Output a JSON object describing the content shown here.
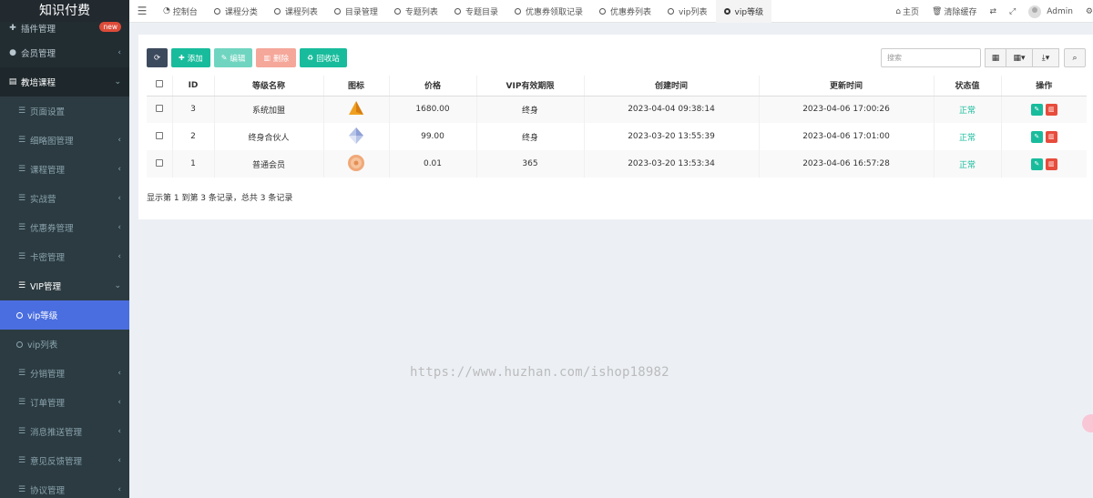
{
  "logo": "知识付费",
  "sidebar": {
    "first": {
      "label": "插件管理",
      "badge": "new"
    },
    "items": [
      {
        "label": "会员管理",
        "icon": "user-icon"
      },
      {
        "label": "教培课程",
        "icon": "book-icon"
      },
      {
        "label": "页面设置",
        "icon": "list-icon"
      },
      {
        "label": "细略图管理",
        "icon": "list-icon"
      },
      {
        "label": "课程管理",
        "icon": "list-icon"
      },
      {
        "label": "实战营",
        "icon": "list-icon"
      },
      {
        "label": "优惠券管理",
        "icon": "list-icon"
      },
      {
        "label": "卡密管理",
        "icon": "list-icon"
      },
      {
        "label": "VIP管理",
        "icon": "list-icon"
      },
      {
        "label": "vip等级",
        "icon": "circle-icon"
      },
      {
        "label": "vip列表",
        "icon": "circle-icon"
      },
      {
        "label": "分销管理",
        "icon": "list-icon"
      },
      {
        "label": "订单管理",
        "icon": "list-icon"
      },
      {
        "label": "消息推送管理",
        "icon": "list-icon"
      },
      {
        "label": "意见反馈管理",
        "icon": "list-icon"
      },
      {
        "label": "协议管理",
        "icon": "list-icon"
      }
    ]
  },
  "topbar": {
    "tabs": [
      {
        "label": "控制台"
      },
      {
        "label": "课程分类"
      },
      {
        "label": "课程列表"
      },
      {
        "label": "目录管理"
      },
      {
        "label": "专题列表"
      },
      {
        "label": "专题目录"
      },
      {
        "label": "优惠券领取记录"
      },
      {
        "label": "优惠券列表"
      },
      {
        "label": "vip列表"
      },
      {
        "label": "vip等级"
      }
    ],
    "home": "主页",
    "clear_cache": "清除缓存",
    "user": "Admin"
  },
  "toolbar": {
    "add": "添加",
    "edit": "编辑",
    "delete": "删除",
    "recycle": "回收站",
    "search_placeholder": "搜索"
  },
  "table": {
    "headers": [
      "ID",
      "等级名称",
      "图标",
      "价格",
      "VIP有效期限",
      "创建时间",
      "更新时间",
      "状态值",
      "操作"
    ],
    "rows": [
      {
        "id": "3",
        "name": "系统加盟",
        "price": "1680.00",
        "period": "终身",
        "created": "2023-04-04 09:38:14",
        "updated": "2023-04-06 17:00:26",
        "status": "正常"
      },
      {
        "id": "2",
        "name": "终身合伙人",
        "price": "99.00",
        "period": "终身",
        "created": "2023-03-20 13:55:39",
        "updated": "2023-04-06 17:01:00",
        "status": "正常"
      },
      {
        "id": "1",
        "name": "普通会员",
        "price": "0.01",
        "period": "365",
        "created": "2023-03-20 13:53:34",
        "updated": "2023-04-06 16:57:28",
        "status": "正常"
      }
    ],
    "footer": "显示第 1 到第 3 条记录，总共 3 条记录"
  },
  "watermark": "https://www.huzhan.com/ishop18982"
}
